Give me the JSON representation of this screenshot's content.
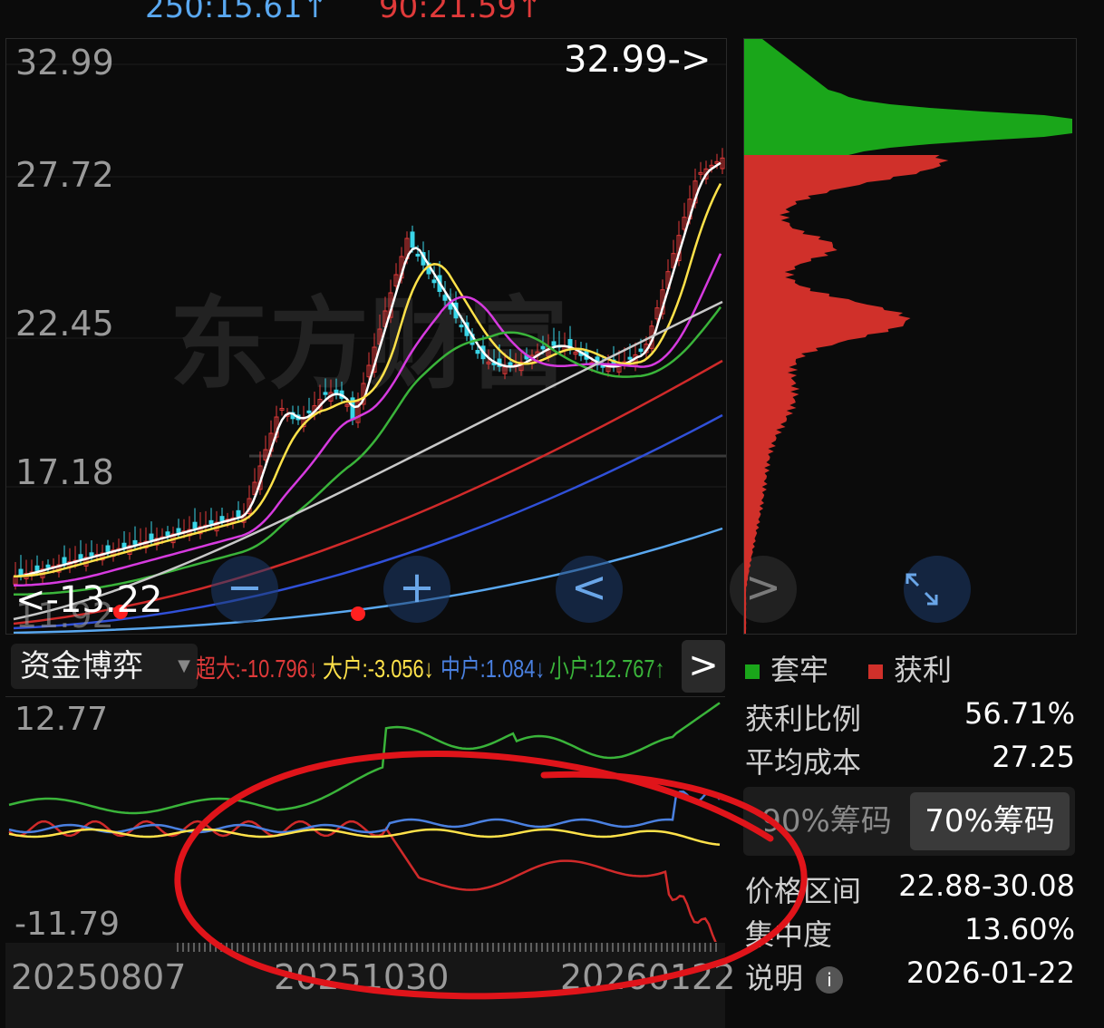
{
  "header": {
    "ma250": "250:15.61↑",
    "ma90": "90:21.59↑"
  },
  "kline": {
    "y_labels": [
      "32.99",
      "27.72",
      "22.45",
      "17.18",
      "11.92"
    ],
    "high_marker": "32.99->",
    "low_marker": "<-13.22",
    "watermark": "东方财富",
    "colors": {
      "up": "#e03a3a",
      "down": "#3ad6e8",
      "ma5": "#ffffff",
      "ma10": "#ffe24a",
      "ma20": "#d63adf",
      "ma30": "#3ab43a",
      "ma60": "#c8c8c8",
      "ma120": "#d02a2a",
      "ma250": "#3050d8",
      "ma_long": "#5aa8f0"
    }
  },
  "nav": {
    "zoom_out": "−",
    "zoom_in": "+",
    "prev": "<",
    "next": ">",
    "fullscreen": "expand-icon"
  },
  "indicator": {
    "name": "资金博弈",
    "super": "超大:-10.796↓",
    "large": "大户:-3.056↓",
    "medium": "中户:1.084↓",
    "small": "小户:12.767↑",
    "next": ">",
    "y_max": "12.77",
    "y_min": "-11.79"
  },
  "dates": [
    "20250807",
    "20251030",
    "20260122"
  ],
  "chips": {
    "legend_trapped": "套牢",
    "legend_profit": "获利",
    "colors": {
      "trapped": "#1aa61a",
      "profit": "#d0302a"
    },
    "profit_ratio_label": "获利比例",
    "profit_ratio": "56.71%",
    "avg_cost_label": "平均成本",
    "avg_cost": "27.25",
    "tab_90": "90%筹码",
    "tab_70": "70%筹码",
    "price_range_label": "价格区间",
    "price_range": "22.88-30.08",
    "concentration_label": "集中度",
    "concentration": "13.60%",
    "note_label": "说明",
    "note_date": "2026-01-22"
  }
}
